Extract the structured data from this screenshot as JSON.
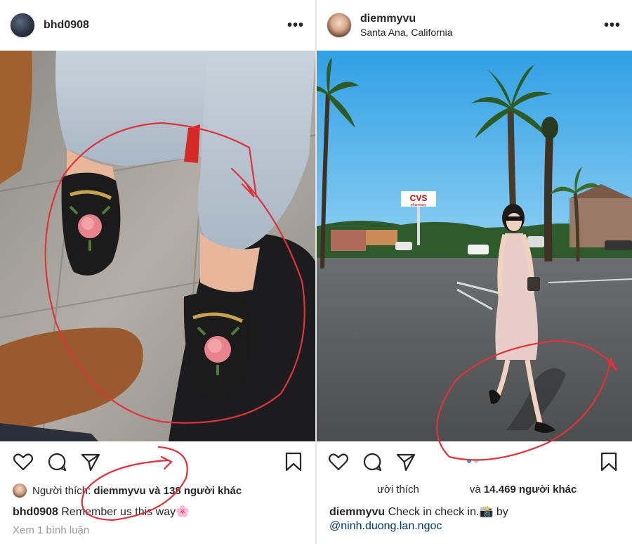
{
  "left_post": {
    "username": "bhd0908",
    "likes_prefix": "Người thích:",
    "likes_user": "diemmyvu",
    "likes_suffix": "và 138 người khác",
    "caption_user": "bhd0908",
    "caption_text": "Remember us this way",
    "caption_emoji": "🌸",
    "comments_link": "Xem 1 bình luận"
  },
  "right_post": {
    "username": "diemmyvu",
    "location": "Santa Ana, California",
    "likes_prefix": "ười thích",
    "likes_suffix": "và",
    "likes_count": "14.469 người khác",
    "caption_user": "diemmyvu",
    "caption_text": "Check in check in.",
    "caption_emoji": "📸",
    "caption_by": "by",
    "caption_mention": "@ninh.duong.lan.ngoc",
    "sign_text": "CVS",
    "sign_sub": "pharmacy"
  },
  "icons": [
    "more-icon",
    "heart-icon",
    "comment-icon",
    "share-icon",
    "bookmark-icon"
  ],
  "colors": {
    "annotation_red": "#e0323c",
    "carousel_active": "#3897f0",
    "carousel_inactive": "#c7c7c7",
    "sky": "#39a8e6"
  }
}
